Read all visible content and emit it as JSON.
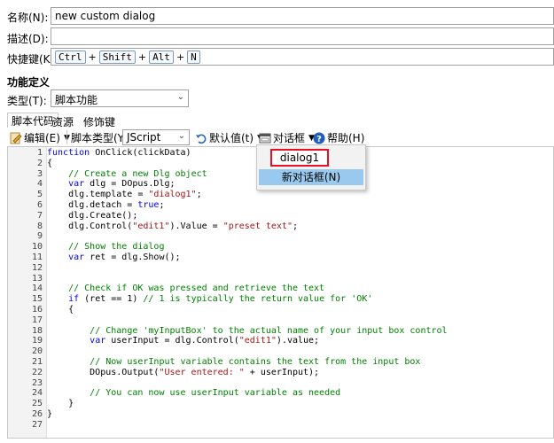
{
  "form": {
    "name_label": "名称(N):",
    "name_value": "new custom dialog",
    "desc_label": "描述(D):",
    "desc_value": "",
    "hotkey_label": "快捷键(K):",
    "hotkeys": [
      "Ctrl",
      "Shift",
      "Alt",
      "N"
    ],
    "section_title": "功能定义",
    "type_label": "类型(T):",
    "type_value": "脚本功能"
  },
  "tabs": [
    "脚本代码",
    "资源",
    "修饰键"
  ],
  "toolbar": {
    "edit_label": "编辑(E)",
    "script_type_label": "脚本类型(Y):",
    "script_type_value": "JScript",
    "default_label": "默认值(t)",
    "dialog_label": "对话框",
    "help_label": "帮助(H)"
  },
  "dropdown": {
    "item1": "dialog1",
    "item2": "新对话框(N)"
  },
  "code_lines": [
    "function OnClick(clickData)",
    "{",
    "    // Create a new Dlg object",
    "    var dlg = DOpus.Dlg;",
    "    dlg.template = \"dialog1\";",
    "    dlg.detach = true;",
    "    dlg.Create();",
    "    dlg.Control(\"edit1\").Value = \"preset text\";",
    "",
    "    // Show the dialog",
    "    var ret = dlg.Show();",
    "",
    "",
    "    // Check if OK was pressed and retrieve the text",
    "    if (ret == 1) // 1 is typically the return value for 'OK'",
    "    {",
    "",
    "        // Change 'myInputBox' to the actual name of your input box control",
    "        var userInput = dlg.Control(\"edit1\").value;",
    "",
    "        // Now userInput variable contains the text from the input box",
    "        DOpus.Output(\"User entered: \" + userInput);",
    "",
    "        // You can now use userInput variable as needed",
    "    }",
    "}",
    ""
  ],
  "colors": {
    "keyword": "#0000ff",
    "string": "#a31515",
    "comment": "#008000",
    "highlight_border": "#e81123",
    "selection": "#99c9ef"
  }
}
